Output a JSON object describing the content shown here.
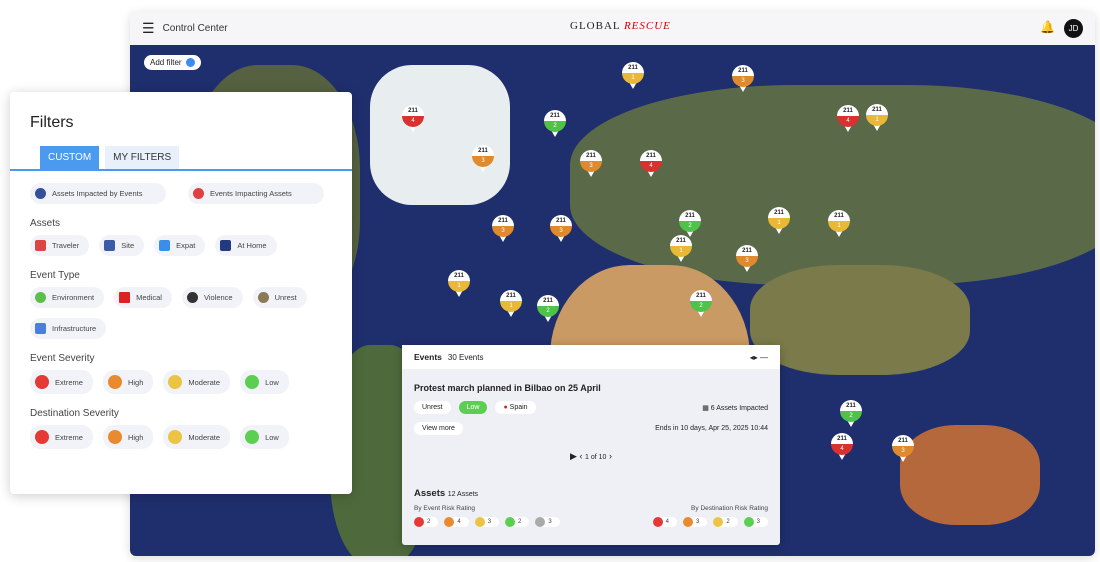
{
  "header": {
    "title": "Control Center",
    "logo_a": "GLOBAL",
    "logo_b": "RESCUE",
    "avatar": "JD"
  },
  "map": {
    "add_filter": "Add filter",
    "markers": [
      {
        "count": "211",
        "level": "1",
        "color": "#e8b937"
      },
      {
        "count": "211",
        "level": "3",
        "color": "#e08a2e"
      },
      {
        "count": "211",
        "level": "4",
        "color": "#d93030"
      },
      {
        "count": "211",
        "level": "2",
        "color": "#4fc24a"
      },
      {
        "count": "211",
        "level": "4",
        "color": "#d93030"
      },
      {
        "count": "211",
        "level": "1",
        "color": "#e8b937"
      },
      {
        "count": "211",
        "level": "3",
        "color": "#e08a2e"
      },
      {
        "count": "211",
        "level": "4",
        "color": "#d93030"
      },
      {
        "count": "211",
        "level": "3",
        "color": "#e08a2e"
      },
      {
        "count": "211",
        "level": "1",
        "color": "#e8b937"
      },
      {
        "count": "211",
        "level": "3",
        "color": "#e08a2e"
      },
      {
        "count": "211",
        "level": "3",
        "color": "#e08a2e"
      },
      {
        "count": "211",
        "level": "1",
        "color": "#e8b937"
      },
      {
        "count": "211",
        "level": "2",
        "color": "#4fc24a"
      },
      {
        "count": "211",
        "level": "1",
        "color": "#e8b937"
      },
      {
        "count": "211",
        "level": "1",
        "color": "#e8b937"
      },
      {
        "count": "211",
        "level": "3",
        "color": "#e08a2e"
      },
      {
        "count": "211",
        "level": "2",
        "color": "#4fc24a"
      },
      {
        "count": "211",
        "level": "1",
        "color": "#e8b937"
      },
      {
        "count": "211",
        "level": "2",
        "color": "#4fc24a"
      },
      {
        "count": "211",
        "level": "2",
        "color": "#4fc24a"
      },
      {
        "count": "211",
        "level": "4",
        "color": "#d93030"
      },
      {
        "count": "211",
        "level": "3",
        "color": "#e08a2e"
      },
      {
        "count": "211",
        "level": "1",
        "color": "#e8b937"
      }
    ]
  },
  "filters": {
    "title": "Filters",
    "tabs": [
      "CUSTOM",
      "MY FILTERS"
    ],
    "impact": [
      "Assets Impacted by Events",
      "Events Impacting Assets"
    ],
    "assets_label": "Assets",
    "assets": [
      "Traveler",
      "Site",
      "Expat",
      "At Home"
    ],
    "event_type_label": "Event Type",
    "event_types": [
      "Environment",
      "Medical",
      "Violence",
      "Unrest",
      "Infrastructure"
    ],
    "event_severity_label": "Event Severity",
    "destination_severity_label": "Destination Severity",
    "severities": [
      "Extreme",
      "High",
      "Moderate",
      "Low"
    ],
    "colors": {
      "extreme": "#e53935",
      "high": "#e98a2f",
      "moderate": "#ebc443",
      "low": "#5ccf52"
    }
  },
  "events": {
    "title": "Events",
    "count": "30 Events",
    "headline": "Protest march planned in Bilbao on 25 April",
    "type": "Unrest",
    "severity": "Low",
    "country": "Spain",
    "impacted": "6 Assets Impacted",
    "more": "View more",
    "ends": "Ends in 10 days, Apr 25, 2025 10:44",
    "pager": "1 of 10",
    "assets_title": "Assets",
    "assets_count": "12 Assets",
    "by_event": "By Event Risk Rating",
    "by_dest": "By Destination Risk Rating",
    "event_counts": [
      "2",
      "4",
      "3",
      "2",
      "3"
    ],
    "dest_counts": [
      "4",
      "3",
      "2",
      "3"
    ]
  }
}
